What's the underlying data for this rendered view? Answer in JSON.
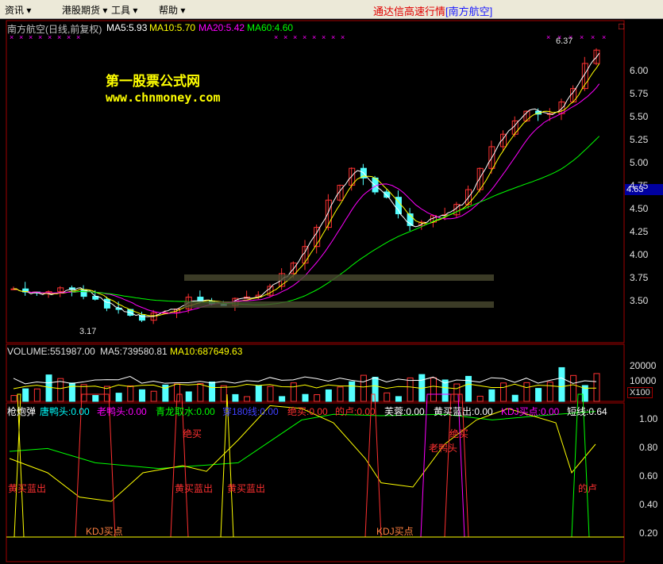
{
  "menu": {
    "items": [
      "资讯",
      "港股期货",
      "工具",
      "帮助"
    ],
    "title_main": "通达信高速行情",
    "title_stock": "[南方航空]"
  },
  "main_chart": {
    "header": {
      "stock": "南方航空(日线,前复权)",
      "ma5": "MA5:5.93",
      "ma10": "MA10:5.70",
      "ma20": "MA20:5.42",
      "ma60": "MA60:4.60"
    },
    "watermark_line1": "第一股票公式网",
    "watermark_line2": "www.chnmoney.com",
    "high_label": "6.37",
    "low_label": "3.17",
    "current_price": "4.63",
    "y_ticks": [
      "6.00",
      "5.75",
      "5.50",
      "5.25",
      "5.00",
      "4.75",
      "4.50",
      "4.25",
      "4.00",
      "3.75",
      "3.50"
    ],
    "corner_mark": "□"
  },
  "volume_chart": {
    "header": {
      "volume": "VOLUME:551987.00",
      "ma5": "MA5:739580.81",
      "ma10": "MA10:687649.63"
    },
    "y_ticks": [
      "20000",
      "10000"
    ],
    "unit": "X100"
  },
  "indicator_chart": {
    "labels": [
      {
        "text": "枪炮弹",
        "color": "#ffffff"
      },
      {
        "text": "唐鸭头:0.00",
        "color": "#00ffff"
      },
      {
        "text": "老鸭头:0.00",
        "color": "#ff00ff"
      },
      {
        "text": "青龙取水:0.00",
        "color": "#00ff00"
      },
      {
        "text": "穿180线:0.00",
        "color": "#0000ff"
      },
      {
        "text": "绝买:0.00",
        "color": "#ff3030"
      },
      {
        "text": "的卢:0.00",
        "color": "#ff3030"
      },
      {
        "text": "芙蓉:0.00",
        "color": "#ffffff"
      },
      {
        "text": "黄买蓝出:0.00",
        "color": "#ffffff"
      },
      {
        "text": "KDJ买点:0.00",
        "color": "#ff00ff"
      },
      {
        "text": "短线:0.64",
        "color": "#ffffff"
      }
    ],
    "y_ticks": [
      "1.00",
      "0.80",
      "0.60",
      "0.40",
      "0.20"
    ],
    "annotations": {
      "a1": "黄买蓝出",
      "a2": "绝买",
      "a3": "黄买蓝出",
      "a4": "黄买蓝出",
      "a5": "KDJ买点",
      "a6": "KDJ买点",
      "a7": "绝买",
      "a8": "老鸭头",
      "a9": "的卢"
    }
  },
  "colors": {
    "up": "#ff3232",
    "down": "#54ffff",
    "ma5": "#ffffff",
    "ma10": "#ffff00",
    "ma20": "#ff00ff",
    "ma60": "#00ff00"
  }
}
